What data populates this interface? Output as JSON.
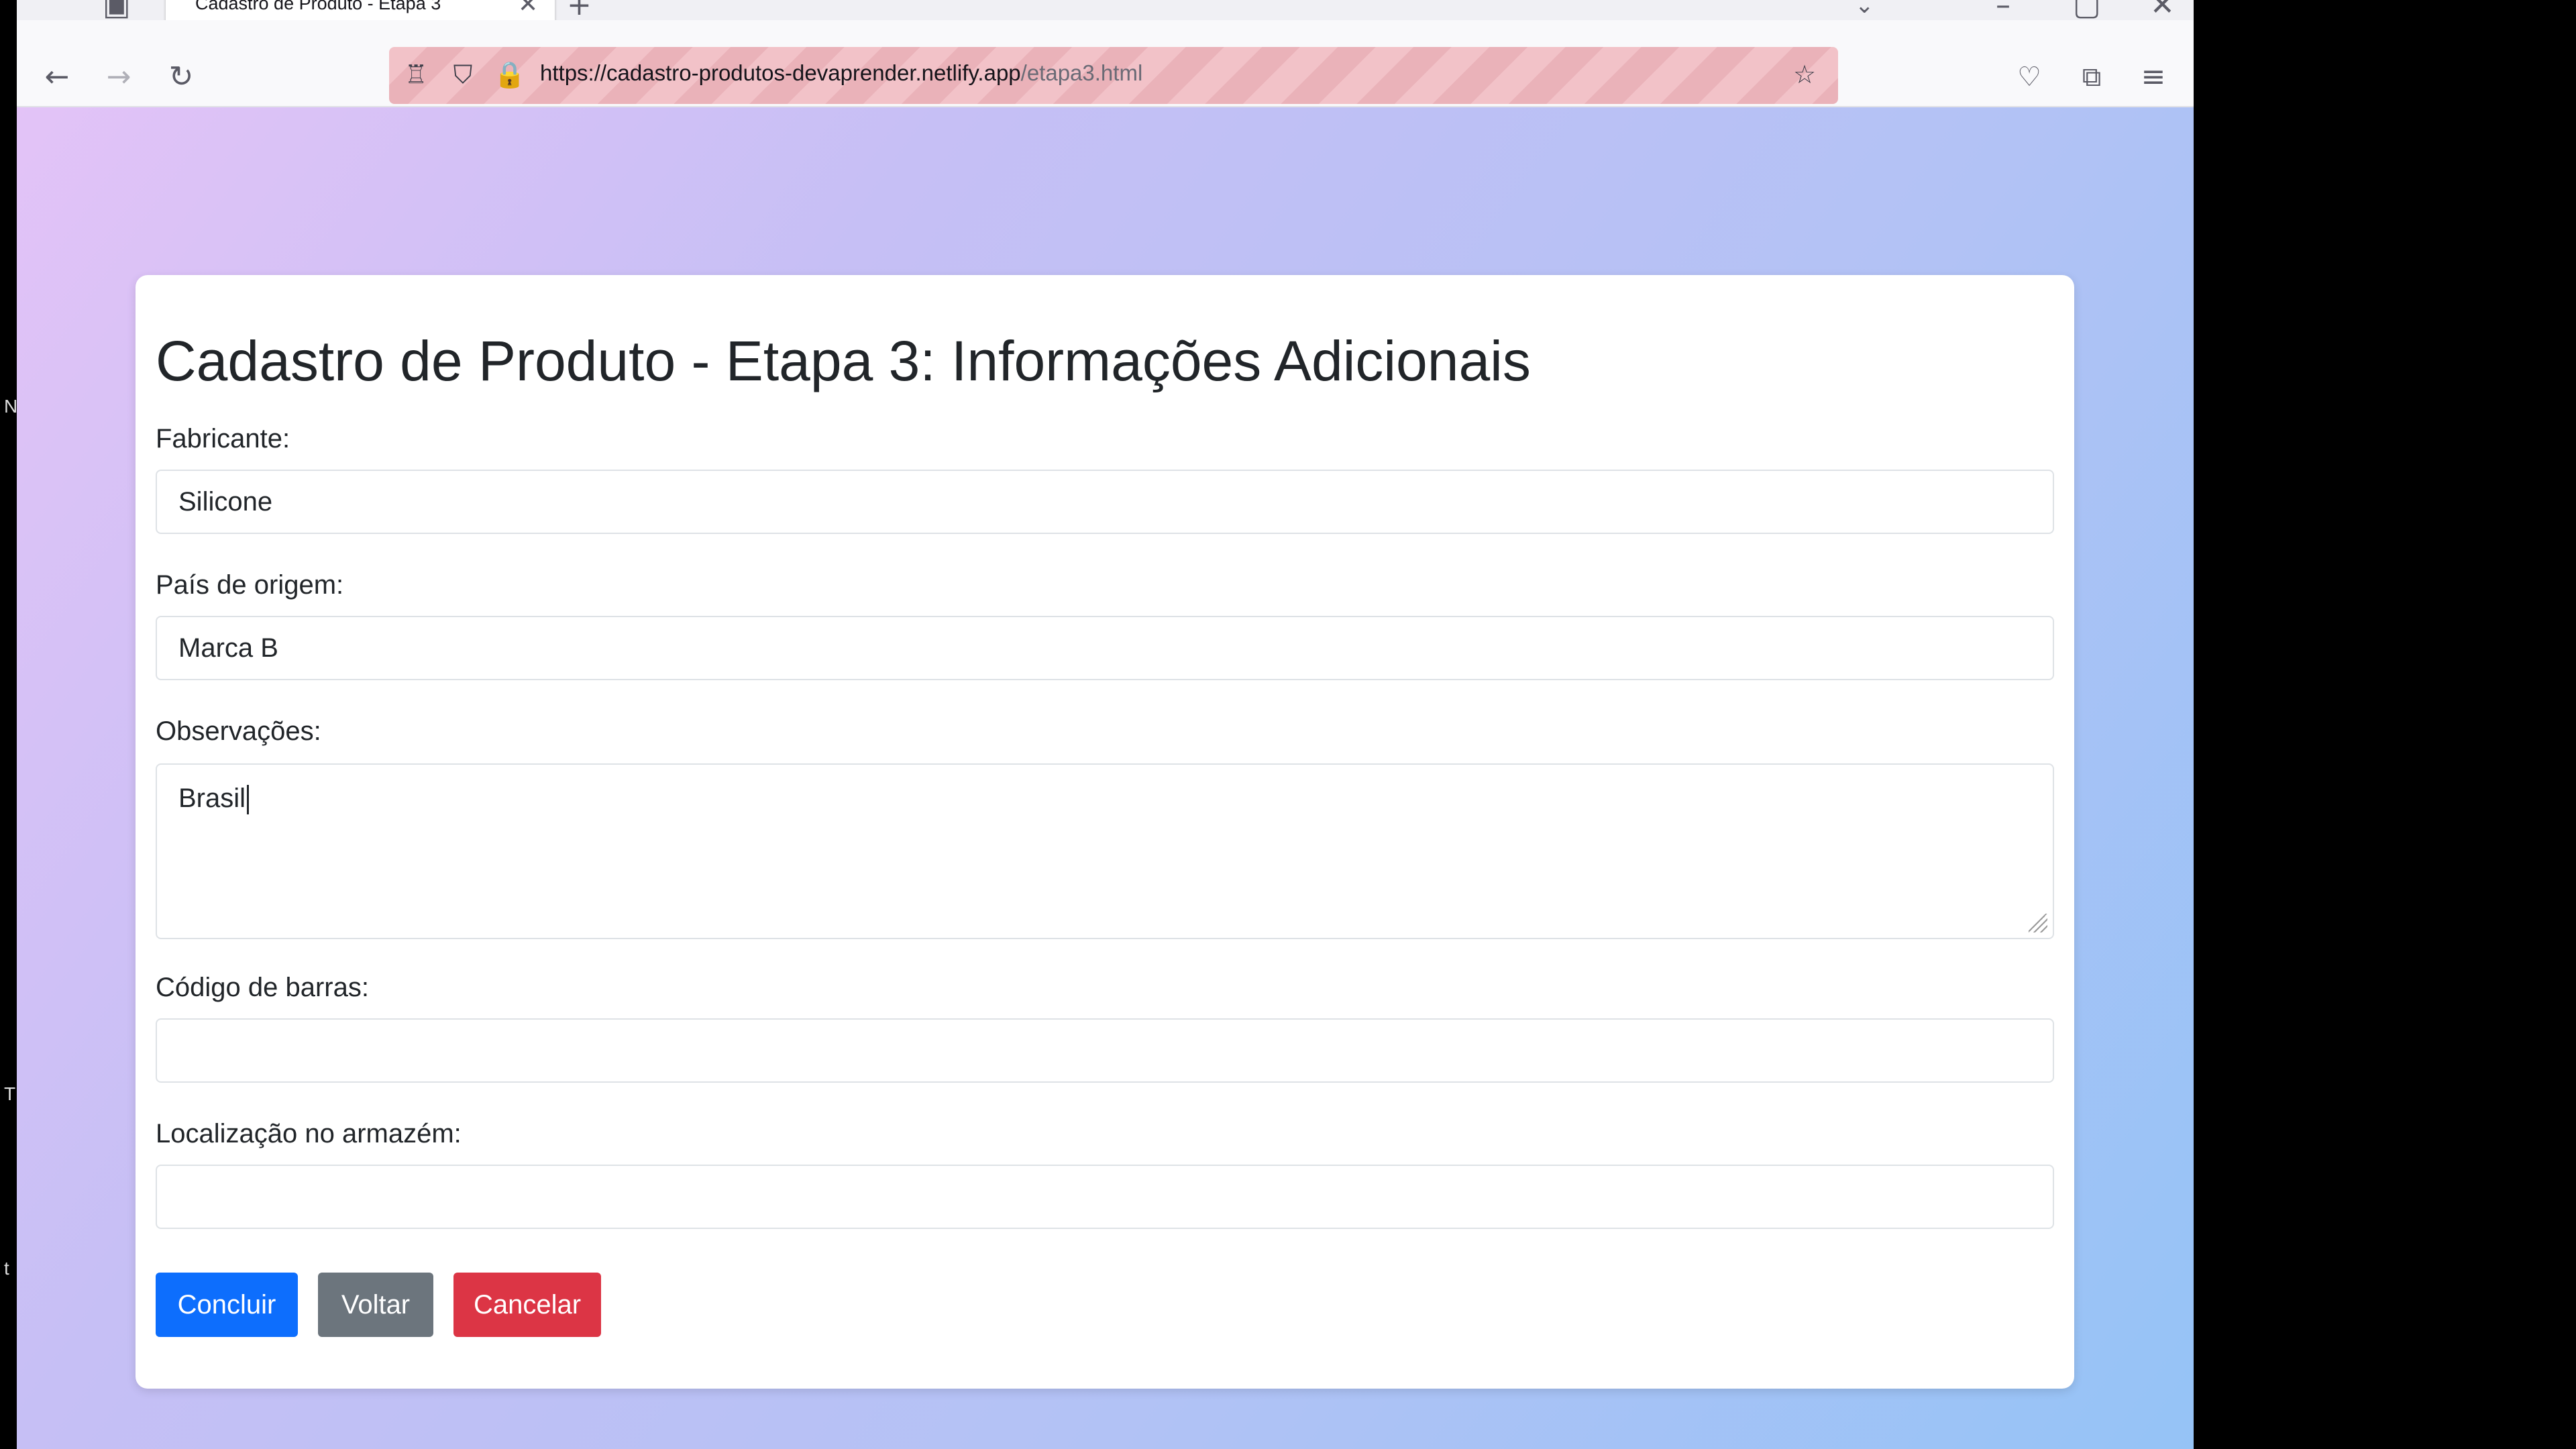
{
  "browser": {
    "tab_title": "Cadastro de Produto - Etapa 3",
    "url_host": "https://cadastro-produtos-devaprender.netlify.app",
    "url_path": "/etapa3.html"
  },
  "page": {
    "title": "Cadastro de Produto - Etapa 3: Informações Adicionais"
  },
  "form": {
    "fabricante": {
      "label": "Fabricante:",
      "value": "Silicone"
    },
    "pais": {
      "label": "País de origem:",
      "value": "Marca B"
    },
    "observacoes": {
      "label": "Observações:",
      "value": "Brasil"
    },
    "codigo": {
      "label": "Código de barras:",
      "value": ""
    },
    "localizacao": {
      "label": "Localização no armazém:",
      "value": ""
    }
  },
  "buttons": {
    "concluir": "Concluir",
    "voltar": "Voltar",
    "cancelar": "Cancelar"
  },
  "colors": {
    "primary": "#0d6efd",
    "secondary": "#6c757d",
    "danger": "#dc3545"
  },
  "left_strip": [
    "N",
    "T",
    "t"
  ]
}
